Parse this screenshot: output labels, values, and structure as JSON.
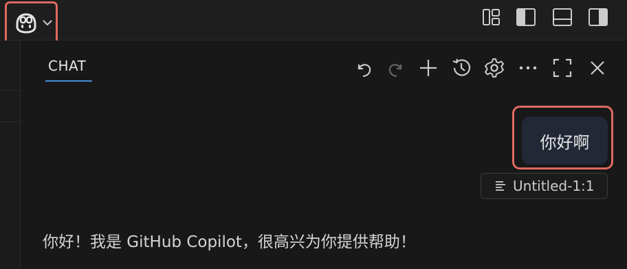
{
  "titlebar": {
    "copilot_menu_icon": "copilot-icon",
    "copilot_menu_chevron": "chevron-down-icon",
    "layout_buttons": [
      "customize-layout-icon",
      "toggle-primary-sidebar-icon",
      "toggle-panel-icon",
      "toggle-secondary-sidebar-icon"
    ]
  },
  "chat": {
    "tab_label": "CHAT",
    "toolbar": [
      "undo-icon",
      "redo-icon",
      "new-chat-icon",
      "history-icon",
      "settings-icon",
      "more-icon",
      "maximize-icon",
      "close-icon"
    ],
    "user_message": "你好啊",
    "reference_file": "Untitled-1:1",
    "assistant_reply": "你好！我是 GitHub Copilot，很高兴为你提供帮助！"
  },
  "colors": {
    "highlight": "#e0695f",
    "tab_underline": "#4a8ddb",
    "user_bubble_bg": "#222836",
    "background": "#181818"
  }
}
